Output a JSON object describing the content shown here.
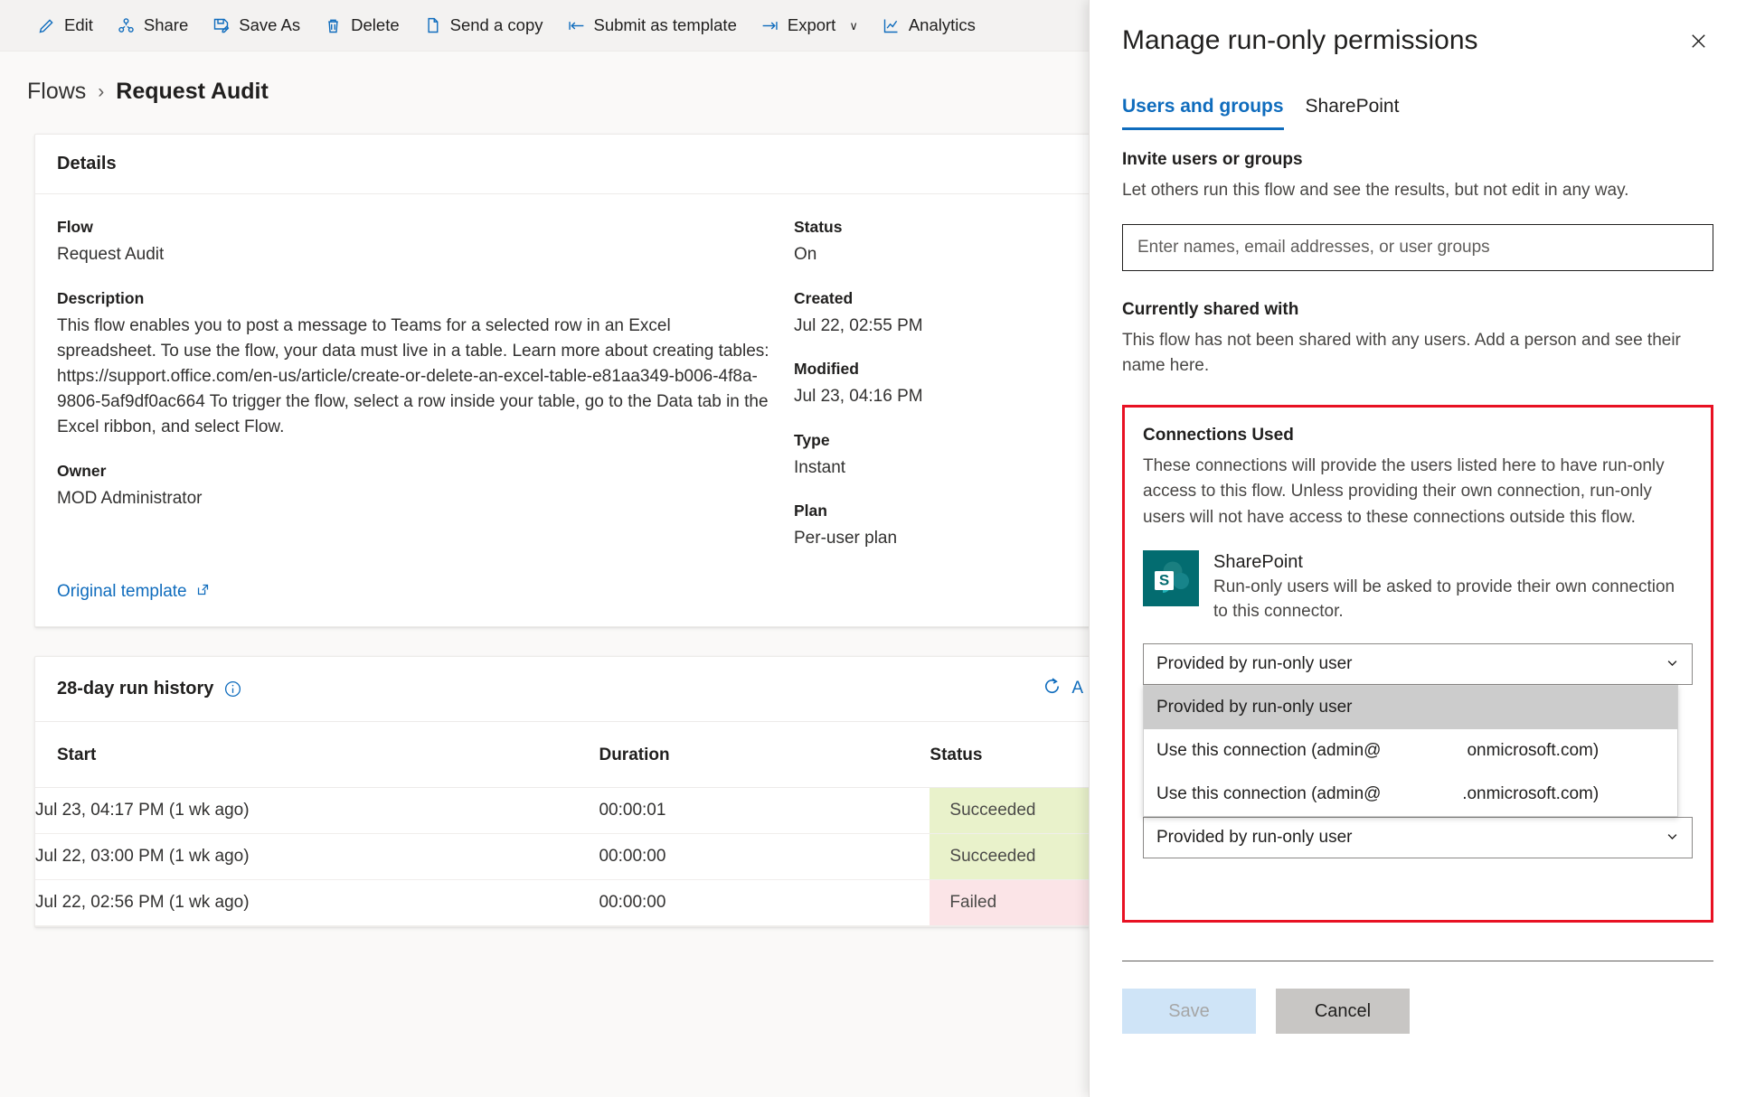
{
  "toolbar": {
    "items": [
      {
        "label": "Edit",
        "icon": "pencil-icon"
      },
      {
        "label": "Share",
        "icon": "share-icon"
      },
      {
        "label": "Save As",
        "icon": "save-as-icon"
      },
      {
        "label": "Delete",
        "icon": "trash-icon"
      },
      {
        "label": "Send a copy",
        "icon": "copy-icon"
      },
      {
        "label": "Submit as template",
        "icon": "arrow-left-bar-icon"
      },
      {
        "label": "Export",
        "icon": "arrow-right-bar-icon",
        "caret": "∨"
      },
      {
        "label": "Analytics",
        "icon": "analytics-icon"
      }
    ]
  },
  "breadcrumb": {
    "root": "Flows",
    "separator": "›",
    "current": "Request Audit"
  },
  "details": {
    "heading": "Details",
    "flow_label": "Flow",
    "flow_value": "Request Audit",
    "description_label": "Description",
    "description_value": "This flow enables you to post a message to Teams for a selected row in an Excel spreadsheet. To use the flow, your data must live in a table. Learn more about creating tables: https://support.office.com/en-us/article/create-or-delete-an-excel-table-e81aa349-b006-4f8a-9806-5af9df0ac664 To trigger the flow, select a row inside your table, go to the Data tab in the Excel ribbon, and select Flow.",
    "owner_label": "Owner",
    "owner_value": "MOD Administrator",
    "status_label": "Status",
    "status_value": "On",
    "created_label": "Created",
    "created_value": "Jul 22, 02:55 PM",
    "modified_label": "Modified",
    "modified_value": "Jul 23, 04:16 PM",
    "type_label": "Type",
    "type_value": "Instant",
    "plan_label": "Plan",
    "plan_value": "Per-user plan",
    "original_template_link": "Original template"
  },
  "run_history": {
    "heading": "28-day run history",
    "info_icon": "info-icon",
    "refresh_icon": "refresh-icon",
    "refresh_label": "A",
    "columns": [
      "Start",
      "Duration",
      "Status"
    ],
    "rows": [
      {
        "start": "Jul 23, 04:17 PM (1 wk ago)",
        "duration": "00:00:01",
        "status": "Succeeded",
        "state": "ok"
      },
      {
        "start": "Jul 22, 03:00 PM (1 wk ago)",
        "duration": "00:00:00",
        "status": "Succeeded",
        "state": "ok"
      },
      {
        "start": "Jul 22, 02:56 PM (1 wk ago)",
        "duration": "00:00:00",
        "status": "Failed",
        "state": "fail"
      }
    ]
  },
  "panel": {
    "title": "Manage run-only permissions",
    "close_icon": "close-icon",
    "tabs": [
      {
        "label": "Users and groups",
        "active": true
      },
      {
        "label": "SharePoint",
        "active": false
      }
    ],
    "invite": {
      "heading": "Invite users or groups",
      "description": "Let others run this flow and see the results, but not edit in any way.",
      "placeholder": "Enter names, email addresses, or user groups",
      "value": ""
    },
    "shared": {
      "heading": "Currently shared with",
      "description": "This flow has not been shared with any users. Add a person and see their name here."
    },
    "connections": {
      "heading": "Connections Used",
      "description": "These connections will provide the users listed here to have run-only access to this flow. Unless providing their own connection, run-only users will not have access to these connections outside this flow.",
      "border_color": "#e81123",
      "connector": {
        "name": "SharePoint",
        "icon": "sharepoint-icon",
        "icon_color": "#036c70",
        "description": "Run-only users will be asked to provide their own connection to this connector."
      },
      "select": {
        "value": "Provided by run-only user",
        "chevron_icon": "chevron-down-icon",
        "options": [
          {
            "label": "Provided by run-only user",
            "selected": true
          },
          {
            "label": "Use this connection (admin@                  onmicrosoft.com)",
            "selected": false
          },
          {
            "label": "Use this connection (admin@                 .onmicrosoft.com)",
            "selected": false
          }
        ]
      },
      "select_secondary": {
        "value": "Provided by run-only user",
        "chevron_icon": "chevron-down-icon"
      }
    },
    "buttons": {
      "save": "Save",
      "cancel": "Cancel"
    }
  }
}
